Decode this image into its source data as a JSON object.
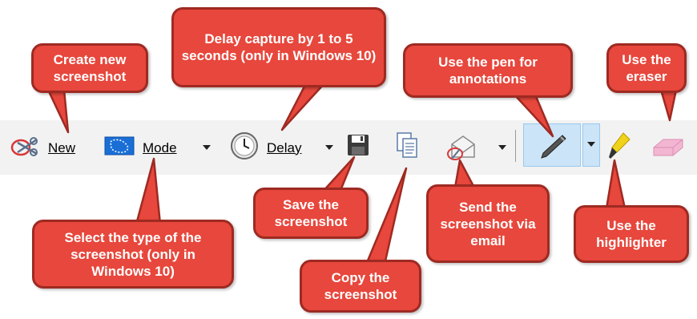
{
  "toolbar": {
    "new_label": "New",
    "mode_label": "Mode",
    "delay_label": "Delay"
  },
  "callouts": {
    "create_new": "Create new screenshot",
    "delay": "Delay capture by 1 to 5 seconds (only in Windows 10)",
    "pen": "Use the pen for annotations",
    "eraser": "Use the eraser",
    "select_type": "Select the type of the screenshot (only in Windows 10)",
    "save": "Save the screenshot",
    "copy": "Copy the screenshot",
    "send": "Send the screenshot via email",
    "highlighter": "Use the highlighter"
  },
  "colors": {
    "callout_fill": "#e7473c",
    "callout_border": "#9e2a22",
    "toolbar_bg": "#f2f2f2",
    "pen_active_bg": "#cce4f7"
  }
}
